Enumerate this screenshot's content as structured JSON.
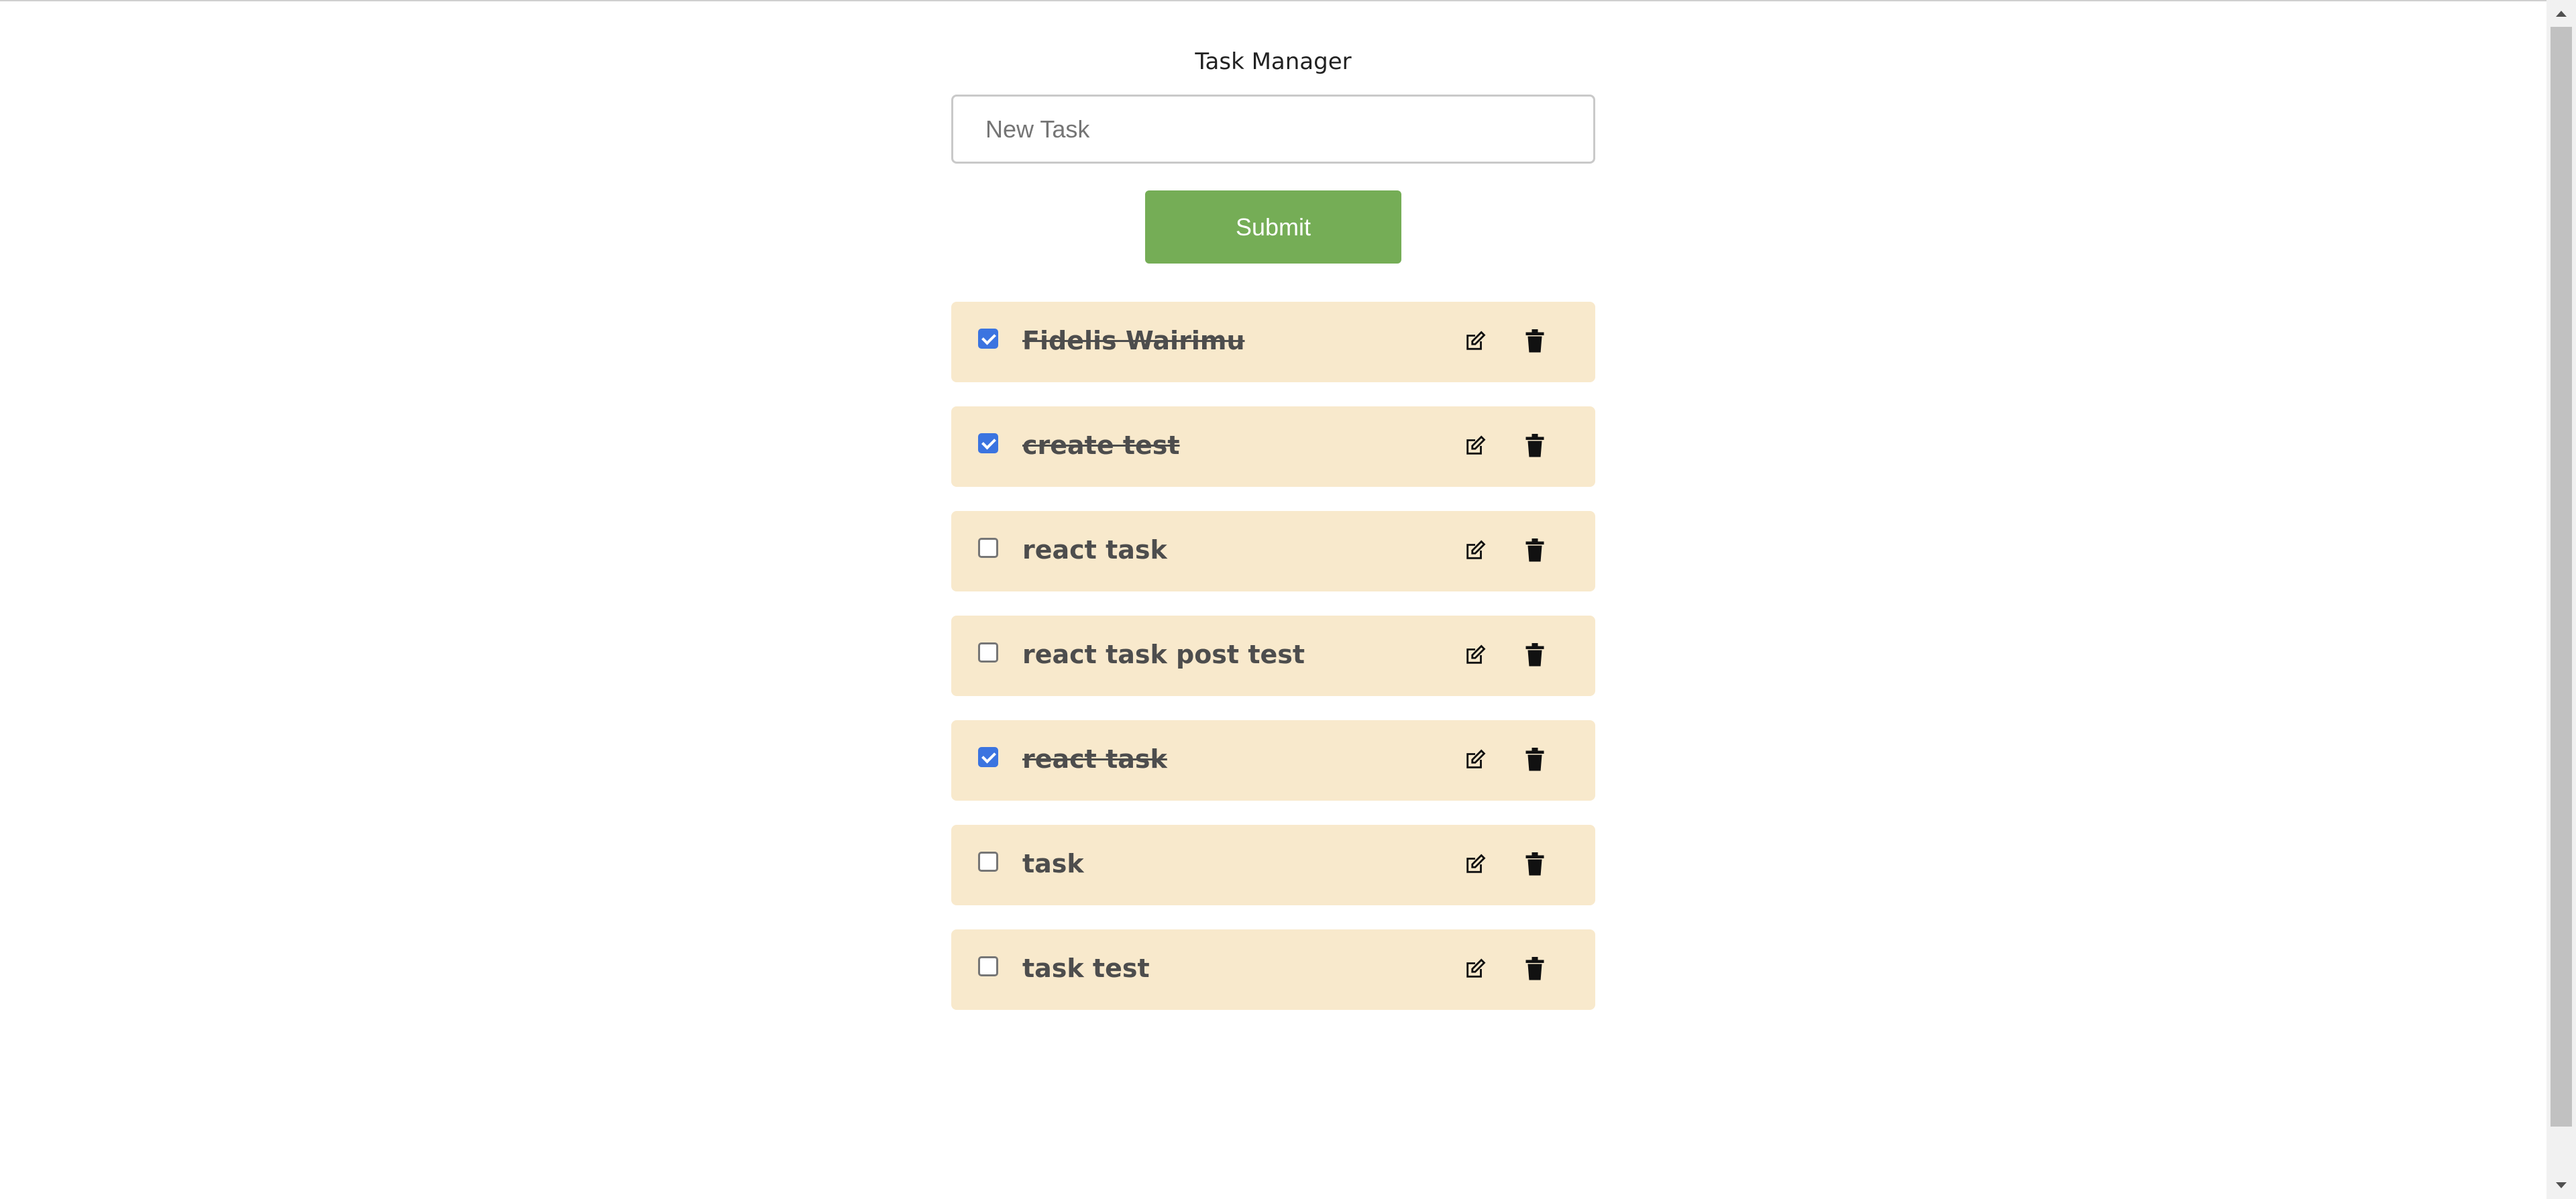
{
  "app": {
    "title": "Task Manager"
  },
  "form": {
    "input_value": "",
    "input_placeholder": "New Task",
    "submit_label": "Submit"
  },
  "tasks": [
    {
      "text": "Fidelis Wairimu",
      "completed": true
    },
    {
      "text": "create test",
      "completed": true
    },
    {
      "text": "react task",
      "completed": false
    },
    {
      "text": "react task post test",
      "completed": false
    },
    {
      "text": "react task",
      "completed": true
    },
    {
      "text": "task",
      "completed": false
    },
    {
      "text": "task test",
      "completed": false
    }
  ],
  "icons": {
    "edit": "edit-icon",
    "delete": "trash-icon"
  },
  "colors": {
    "accent": "#75ad56",
    "task_background": "#f8e9cc",
    "checkbox_checked": "#3b74e0",
    "task_text": "#4d4d4d"
  }
}
